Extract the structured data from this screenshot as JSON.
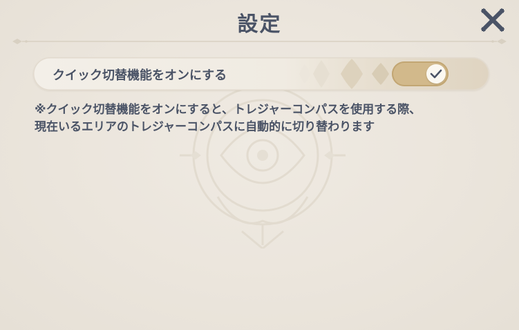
{
  "dialog": {
    "title": "設定",
    "close_icon": "close-icon"
  },
  "option": {
    "label": "クイック切替機能をオンにする",
    "toggle_state": "on",
    "toggle_icon": "checkmark-icon"
  },
  "note": {
    "line1": "※クイック切替機能をオンにすると、トレジャーコンパスを使用する際、",
    "line2": "現在いるエリアのトレジャーコンパスに自動的に切り替わります"
  },
  "colors": {
    "background": "#ebe6dd",
    "text": "#4a5366",
    "toggle_on": "#d2b98b",
    "accent_gold": "#c9ae7a"
  }
}
